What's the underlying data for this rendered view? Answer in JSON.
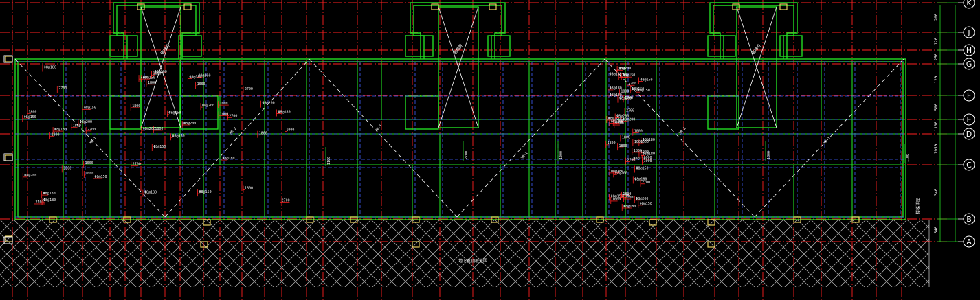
{
  "drawing": {
    "background": "#000000",
    "colors": {
      "axis": "#ff2020",
      "wall": "#22dd22",
      "dashed": "#4060ff",
      "beam": "#ff2020",
      "dim": "#22dd22",
      "hatch": "#cfcfcf",
      "column": "#e8d060",
      "text": "#ffffff"
    },
    "axis_labels": [
      "K",
      "J",
      "H",
      "G",
      "F",
      "E",
      "D",
      "C",
      "B",
      "A"
    ],
    "axis_dimensions": [
      "200",
      "120",
      "250",
      "120",
      "500",
      "1100",
      "1950",
      "340",
      "540"
    ],
    "room_dims": [
      "1100",
      "2700",
      "1000",
      "1800",
      "1100",
      "1000"
    ],
    "slab_tags": [
      "Φ8@150",
      "Φ8@200",
      "Φ8@180"
    ],
    "diagonal_labels": [
      "XB-1",
      "XB-2"
    ],
    "elevator_label": "电梯井",
    "ground_note": "地下室顶板范围",
    "side_note": "楼梯详图"
  }
}
